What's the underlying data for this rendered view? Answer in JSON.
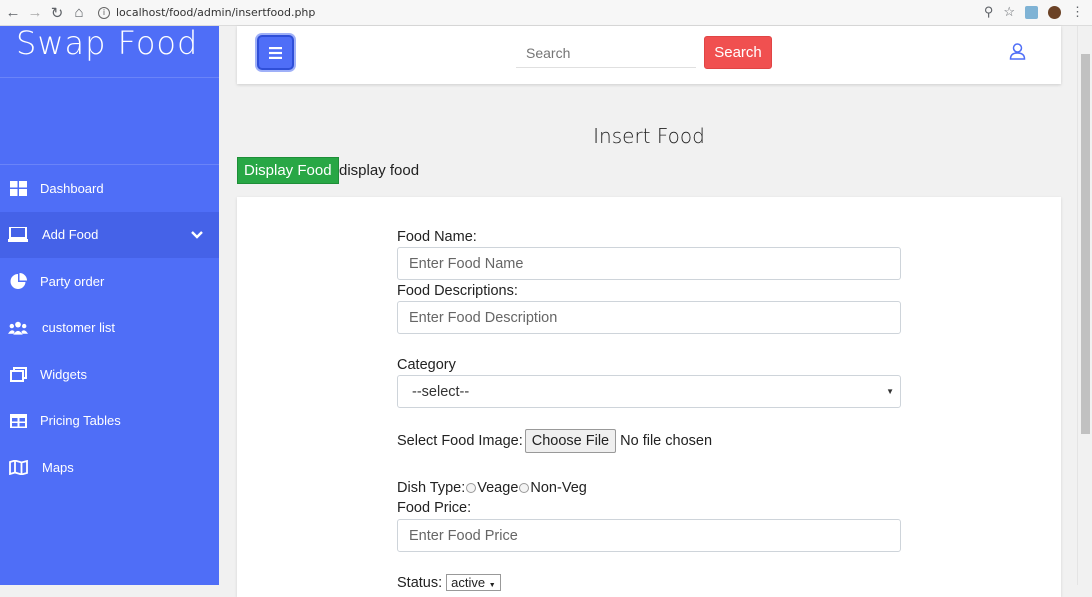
{
  "browser": {
    "url": "localhost/food/admin/insertfood.php"
  },
  "sidebar": {
    "brand": "Swap Food",
    "items": [
      {
        "label": "Dashboard",
        "icon": "grid-icon"
      },
      {
        "label": "Add Food",
        "icon": "laptop-icon"
      },
      {
        "label": "Party order",
        "icon": "pie-chart-icon"
      },
      {
        "label": "customer list",
        "icon": "users-icon"
      },
      {
        "label": "Widgets",
        "icon": "windows-icon"
      },
      {
        "label": "Pricing Tables",
        "icon": "table-icon"
      },
      {
        "label": "Maps",
        "icon": "map-icon"
      }
    ],
    "accent": "#4f6ef7"
  },
  "topbar": {
    "search_placeholder": "Search",
    "search_button": "Search",
    "search_button_color": "#f05050"
  },
  "main": {
    "title": "Insert Food",
    "display_button": "Display Food",
    "display_text": "display food",
    "display_button_color": "#28a745"
  },
  "form": {
    "food_name_label": "Food Name:",
    "food_name_placeholder": "Enter Food Name",
    "food_desc_label": "Food Descriptions:",
    "food_desc_placeholder": "Enter Food Description",
    "category_label": "Category",
    "category_value": "--select--",
    "image_label": "Select Food Image:",
    "choose_file": "Choose File",
    "no_file": "No file chosen",
    "dish_type_label": "Dish Type:",
    "dish_option_1": "Veage",
    "dish_option_2": "Non-Veg",
    "price_label": "Food Price:",
    "price_placeholder": "Enter Food Price",
    "status_label": "Status:",
    "status_value": "active"
  }
}
